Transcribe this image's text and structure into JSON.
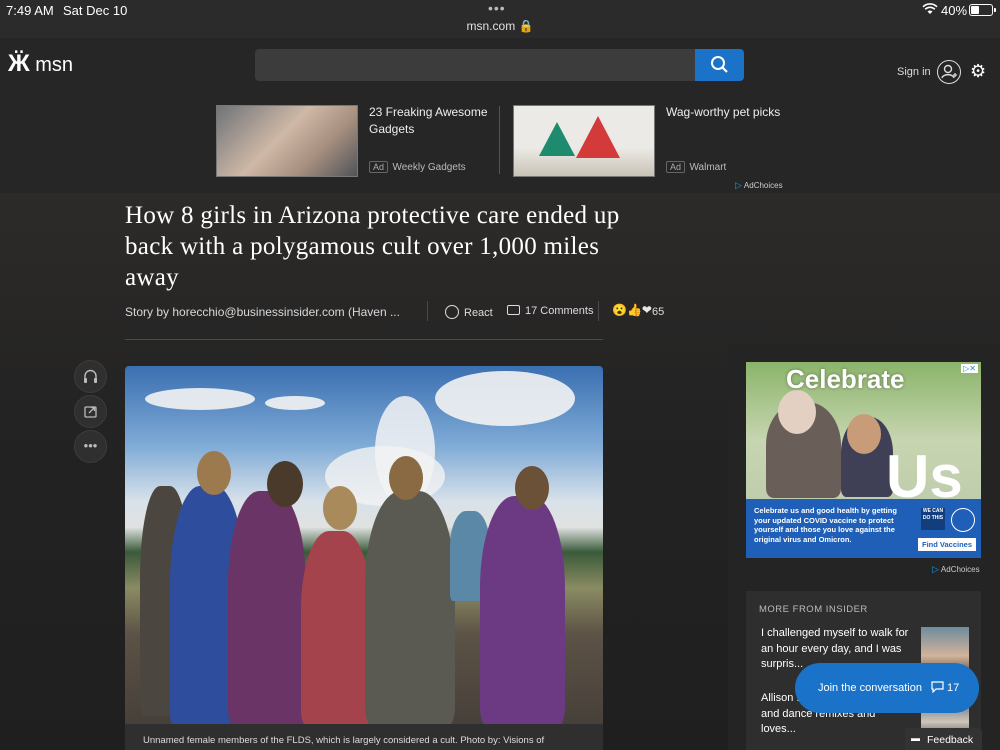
{
  "status_bar": {
    "time": "7:49 AM",
    "date": "Sat Dec 10",
    "url": "msn.com 🔒",
    "battery": "40%",
    "battery_level": 0.4
  },
  "header": {
    "logo": "msn",
    "search_placeholder": "",
    "sign_in": "Sign in"
  },
  "ads": [
    {
      "title": "23 Freaking Awesome Gadgets",
      "tag": "Ad",
      "source": "Weekly Gadgets"
    },
    {
      "title": "Wag-worthy pet picks",
      "tag": "Ad",
      "source": "Walmart"
    }
  ],
  "adchoices": "AdChoices",
  "article": {
    "headline": "How 8 girls in Arizona protective care ended up back with a polygamous cult over 1,000 miles away",
    "byline": "Story by horecchio@businessinsider.com (Haven ...",
    "react": "React",
    "comments": "17 Comments",
    "reactions_emoji": "😮👍❤",
    "reactions_count": "65",
    "caption": "Unnamed female members of the FLDS, which is largely considered a cult. Photo by: Visions of"
  },
  "right_ad": {
    "headline_top": "Celebrate",
    "headline_bottom": "Us",
    "body": "Celebrate us and good health by getting your updated COVID vaccine to protect yourself and those you love against the original virus and Omicron.",
    "button": "Find Vaccines",
    "logo_text": "WE CAN DO THIS",
    "adchoices": "AdChoices"
  },
  "more_from": {
    "label": "MORE FROM INSIDER",
    "stories": [
      {
        "title": "I challenged myself to walk for an hour every day, and I was surpris..."
      },
      {
        "title": "Allison ... your 'M3gan' memes and dance remixes and loves..."
      }
    ]
  },
  "join": {
    "label": "Join the conversation",
    "count": "17"
  },
  "feedback": "Feedback"
}
